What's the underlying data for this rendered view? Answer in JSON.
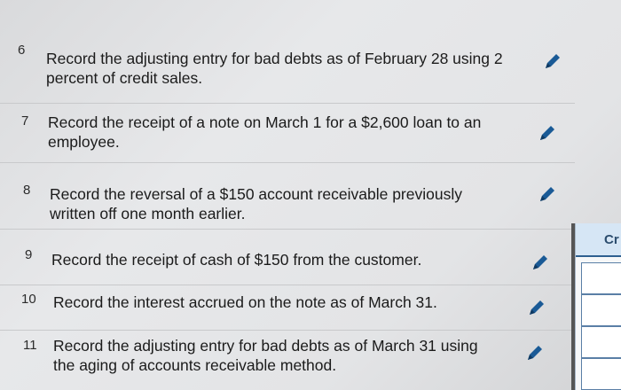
{
  "entries": [
    {
      "number": "6",
      "text": "Record the adjusting entry for bad debts as of February 28 using 2 percent of credit sales."
    },
    {
      "number": "7",
      "text": "Record the receipt of a note on March 1 for a $2,600 loan to an employee."
    },
    {
      "number": "8",
      "text": "Record the reversal of a $150 account receivable previously written off one month earlier."
    },
    {
      "number": "9",
      "text": "Record the receipt of cash of $150 from the customer."
    },
    {
      "number": "10",
      "text": "Record the interest accrued on the note as of March 31."
    },
    {
      "number": "11",
      "text": "Record the adjusting entry for bad debts as of March 31 using the aging of accounts receivable method."
    }
  ],
  "side_panel": {
    "header": "Cr"
  },
  "colors": {
    "edit_icon": "#1a5a96",
    "panel_header": "#d6e6f5",
    "panel_border": "#2f5f8f"
  },
  "icons": {
    "edit": "pencil-icon"
  }
}
